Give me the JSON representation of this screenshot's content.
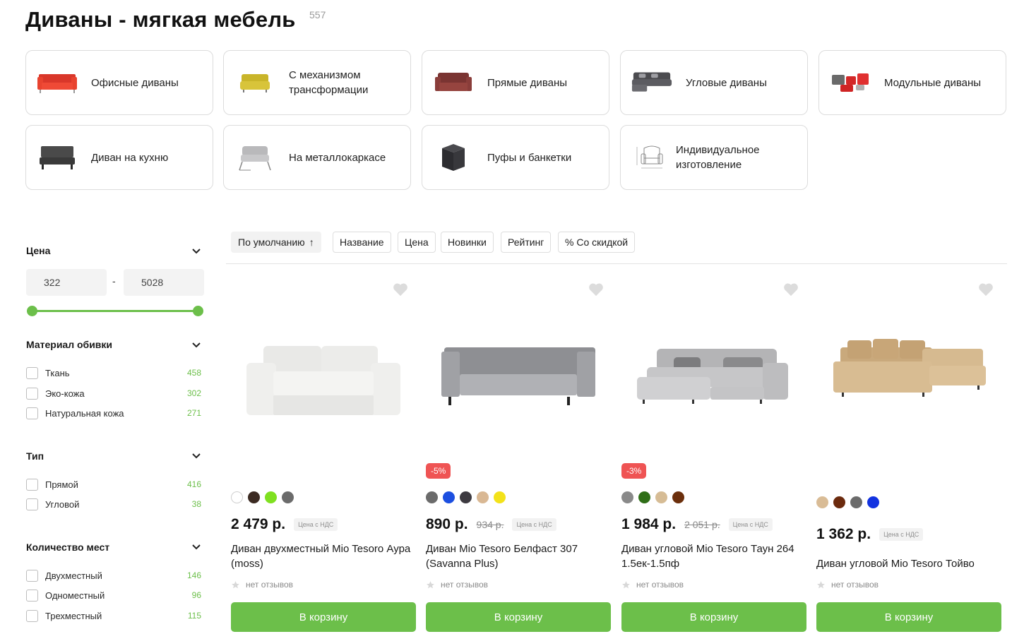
{
  "page": {
    "title": "Диваны - мягкая мебель",
    "count": "557"
  },
  "categories": [
    {
      "label": "Офисные диваны",
      "icon": "red-office-sofa"
    },
    {
      "label": "С механизмом трансформации",
      "icon": "yellow-sofa-bed"
    },
    {
      "label": "Прямые диваны",
      "icon": "brown-straight-sofa"
    },
    {
      "label": "Угловые диваны",
      "icon": "grey-corner-sofa"
    },
    {
      "label": "Модульные диваны",
      "icon": "red-grey-modular-sofa"
    },
    {
      "label": "Диван на кухню",
      "icon": "dark-kitchen-sofa"
    },
    {
      "label": "На металлокаркасе",
      "icon": "metal-frame-sofa"
    },
    {
      "label": "Пуфы и банкетки",
      "icon": "black-pouf"
    },
    {
      "label": "Индивидуальное изготовление",
      "icon": "armchair-sketch"
    }
  ],
  "sort": {
    "options": [
      "По умолчанию",
      "Название",
      "Цена",
      "Новинки",
      "Рейтинг",
      "% Со скидкой"
    ],
    "active": "По умолчанию"
  },
  "filters": {
    "price": {
      "title": "Цена",
      "min": "322",
      "max": "5028",
      "range": [
        0,
        1
      ]
    },
    "material": {
      "title": "Материал обивки",
      "options": [
        {
          "label": "Ткань",
          "count": "458"
        },
        {
          "label": "Эко-кожа",
          "count": "302"
        },
        {
          "label": "Натуральная кожа",
          "count": "271"
        }
      ]
    },
    "type": {
      "title": "Тип",
      "options": [
        {
          "label": "Прямой",
          "count": "416"
        },
        {
          "label": "Угловой",
          "count": "38"
        }
      ]
    },
    "seats": {
      "title": "Количество мест",
      "options": [
        {
          "label": "Двухместный",
          "count": "146"
        },
        {
          "label": "Одноместный",
          "count": "96"
        },
        {
          "label": "Трехместный",
          "count": "115"
        }
      ]
    }
  },
  "products": [
    {
      "name": "Диван двухместный Mio Tesoro Аура (moss)",
      "price": "2 479 р.",
      "old_price": "",
      "discount": "",
      "vat": "Цена с НДС",
      "reviews": "нет отзывов",
      "cart": "В корзину",
      "swatches": [
        "#ffffff",
        "#3b2a22",
        "#7fe020",
        "#6b6b6b"
      ]
    },
    {
      "name": "Диван Mio Tesoro Белфаст 307 (Savanna Plus)",
      "price": "890 р.",
      "old_price": "934 р.",
      "discount": "-5%",
      "vat": "Цена с НДС",
      "reviews": "нет отзывов",
      "cart": "В корзину",
      "swatches": [
        "#6b6b6b",
        "#1c4fe0",
        "#3d3a40",
        "#d9b894",
        "#f3e21a"
      ]
    },
    {
      "name": "Диван угловой Mio Tesoro Таун 264 1.5ек-1.5пф",
      "price": "1 984 р.",
      "old_price": "2 051 р.",
      "discount": "-3%",
      "vat": "Цена с НДС",
      "reviews": "нет отзывов",
      "cart": "В корзину",
      "swatches": [
        "#8a8a8a",
        "#2f6e17",
        "#d6bc95",
        "#6b2f0c"
      ]
    },
    {
      "name": "Диван угловой Mio Tesoro Тойво",
      "price": "1 362 р.",
      "old_price": "",
      "discount": "",
      "vat": "Цена с НДС",
      "reviews": "нет отзывов",
      "cart": "В корзину",
      "swatches": [
        "#d9bc96",
        "#6b2a0d",
        "#6b6b6b",
        "#1232e0"
      ]
    }
  ],
  "colors": {
    "accent": "#6cbf4a",
    "badge": "#ef5454"
  }
}
